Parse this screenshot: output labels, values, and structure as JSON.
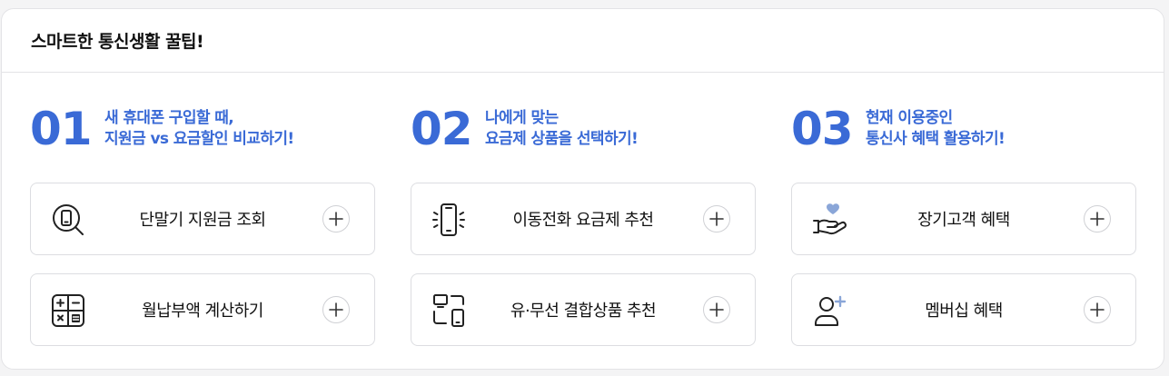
{
  "title": "스마트한 통신생활 꿀팁!",
  "colors": {
    "accent": "#3a6ad6",
    "heart": "#8aa6d8",
    "text": "#111111",
    "border": "#dcdde1"
  },
  "columns": [
    {
      "number": "01",
      "desc_line1": "새 휴대폰 구입할 때,",
      "desc_line2": "지원금 vs 요금할인 비교하기!",
      "cards": [
        {
          "label": "단말기 지원금 조회",
          "icon": "phone-search-icon"
        },
        {
          "label": "월납부액 계산하기",
          "icon": "calculator-icon"
        }
      ]
    },
    {
      "number": "02",
      "desc_line1": "나에게 맞는",
      "desc_line2": "요금제 상품을 선택하기!",
      "cards": [
        {
          "label": "이동전화 요금제 추천",
          "icon": "mobile-ringing-icon"
        },
        {
          "label": "유·무선 결합상품 추천",
          "icon": "bundle-devices-icon"
        }
      ]
    },
    {
      "number": "03",
      "desc_line1": "현재 이용중인",
      "desc_line2": "통신사 혜택 활용하기!",
      "cards": [
        {
          "label": "장기고객 혜택",
          "icon": "heart-hand-icon"
        },
        {
          "label": "멤버십 혜택",
          "icon": "add-member-icon"
        }
      ]
    }
  ]
}
